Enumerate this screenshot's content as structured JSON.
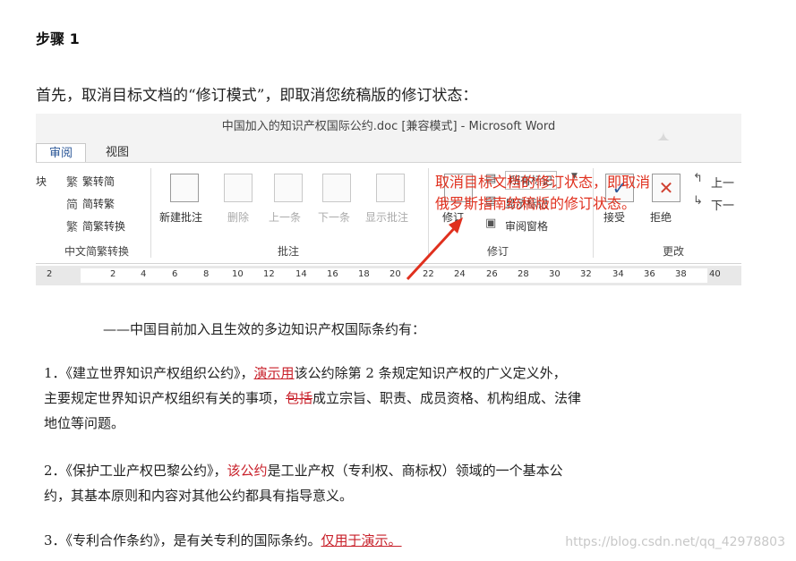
{
  "heading": "步骤 1",
  "intro": "首先，取消目标文档的“修订模式”，即取消您统稿版的修订状态：",
  "word": {
    "title": "中国加入的知识产权国际公约.doc [兼容模式] - Microsoft Word",
    "tabs": [
      "审阅",
      "视图"
    ],
    "left_edge": "块",
    "chinese_group": {
      "items": [
        "繁转简",
        "简转繁",
        "简繁转换"
      ],
      "label": "中文简繁转换"
    },
    "comments_group": {
      "items": [
        "新建批注",
        "删除",
        "上一条",
        "下一条",
        "显示批注"
      ],
      "label": "批注"
    },
    "track_group": {
      "track_button": "修订",
      "markup_select": "所有标记",
      "show_markup": "显示标记",
      "review_pane": "审阅窗格",
      "label": "修订"
    },
    "changes_group": {
      "accept": "接受",
      "reject": "拒绝",
      "prev": "上一",
      "next": "下一",
      "label": "更改"
    },
    "ruler": [
      "2",
      "2",
      "4",
      "6",
      "8",
      "10",
      "12",
      "14",
      "16",
      "18",
      "20",
      "22",
      "24",
      "26",
      "28",
      "30",
      "32",
      "34",
      "36",
      "38",
      "40"
    ],
    "annotation": [
      "取消目标文档的修订状态，即取消",
      "俄罗斯指南统稿版的修订状态。"
    ],
    "doc": {
      "lead": "——中国目前加入且生效的多边知识产权国际条约有：",
      "p1a": "1．《建立世界知识产权组织公约》，",
      "p1b": "演示用",
      "p1c": "该公约除第 2 条规定知识产权的广义定义外，",
      "p1d": "主要规定世界知识产权组织有关的事项，",
      "p1e": "包括",
      "p1f": "成立宗旨、职责、成员资格、机构组成、法律",
      "p1g": "地位等问题。",
      "p2a": "2．《保护工业产权巴黎公约》，",
      "p2b": "该公约",
      "p2c": "是工业产权（专利权、商标权）领域的一个基本公",
      "p2d": "约，其基本原则和内容对其他公约都具有指导意义。",
      "p3a": "3．《专利合作条约》，是有关专利的国际条约。",
      "p3b": "仅用于演示。"
    }
  },
  "watermark": "https://blog.csdn.net/qq_42978803",
  "colors": {
    "annotation": "#e0301e",
    "revision": "#c8202a",
    "tab_accent": "#2b5797"
  }
}
